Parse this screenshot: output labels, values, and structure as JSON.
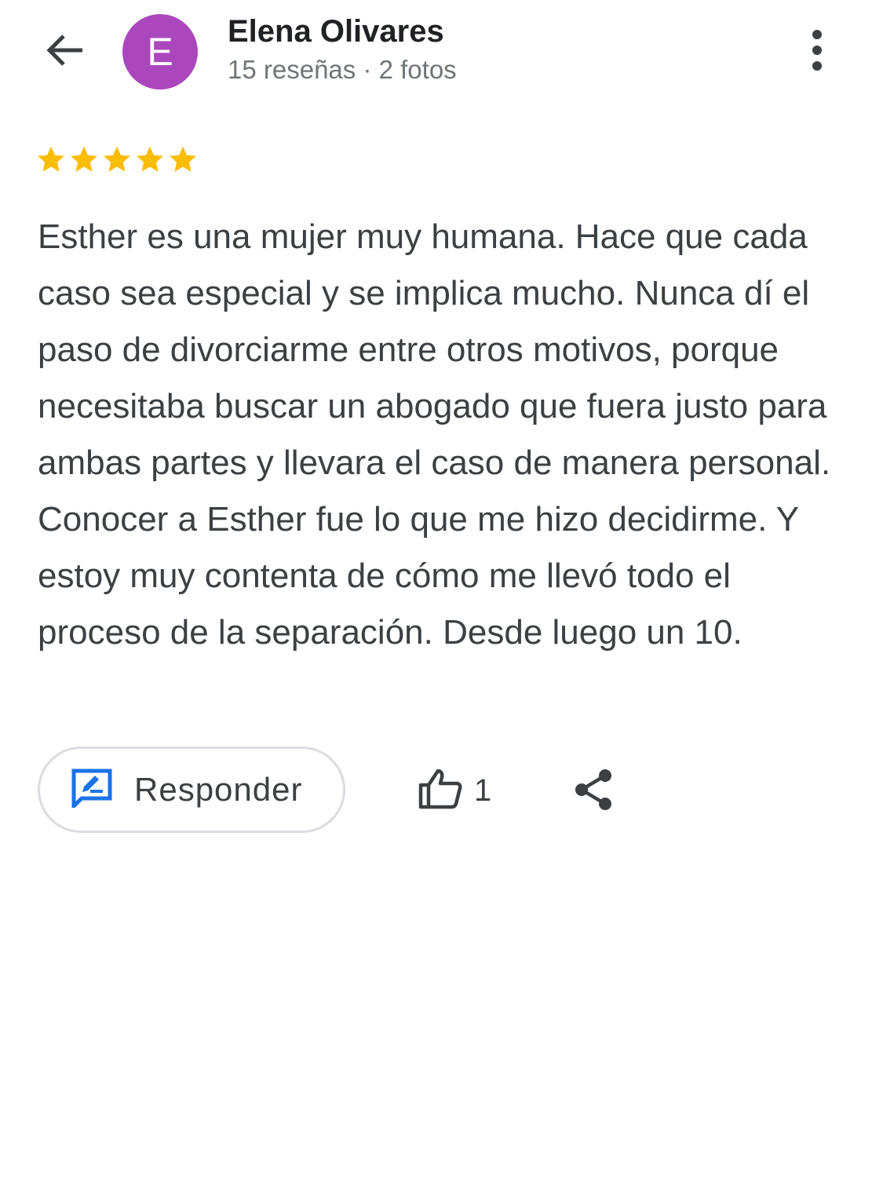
{
  "header": {
    "back_icon": "arrow-back-icon",
    "avatar_letter": "E",
    "avatar_color": "#ab47bc",
    "author_name": "Elena Olivares",
    "author_meta": "15 reseñas · 2 fotos",
    "more_icon": "more-vert-icon"
  },
  "review": {
    "rating": 5,
    "rating_max": 5,
    "star_color": "#fbbc04",
    "text": "Esther es una mujer muy humana. Hace que cada caso sea especial y se implica mucho. Nunca dí el paso de divorciarme entre otros motivos, porque necesitaba buscar un abogado que fuera justo para ambas partes y llevara el caso de manera personal. Conocer a Esther fue lo que me hizo decidirme. Y estoy muy contenta de cómo me llevó todo el proceso de la separación. Desde luego un 10."
  },
  "actions": {
    "reply_label": "Responder",
    "reply_icon": "reply-edit-icon",
    "reply_icon_color": "#1a73e8",
    "like_icon": "thumbs-up-icon",
    "like_count": "1",
    "share_icon": "share-icon"
  }
}
